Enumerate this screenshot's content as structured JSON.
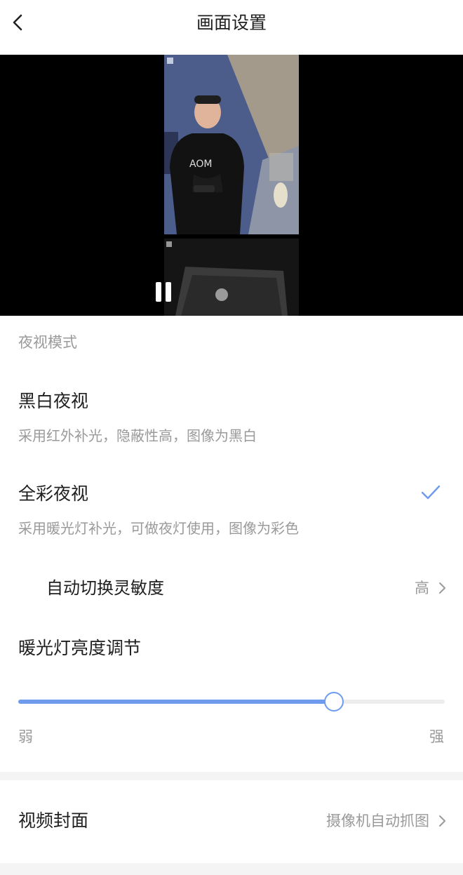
{
  "header": {
    "title": "画面设置"
  },
  "night_vision": {
    "section_label": "夜视模式",
    "options": [
      {
        "title": "黑白夜视",
        "description": "采用红外补光，隐蔽性高，图像为黑白",
        "selected": false
      },
      {
        "title": "全彩夜视",
        "description": "采用暖光灯补光，可做夜灯使用，图像为彩色",
        "selected": true
      }
    ],
    "auto_switch": {
      "label": "自动切换灵敏度",
      "value": "高"
    }
  },
  "brightness": {
    "title": "暖光灯亮度调节",
    "min_label": "弱",
    "max_label": "强",
    "level": 0.74
  },
  "video_cover": {
    "label": "视频封面",
    "value": "摄像机自动抓图"
  },
  "colors": {
    "accent": "#6f9bef",
    "track": "#ededed",
    "muted_text": "#9a9a9a"
  }
}
